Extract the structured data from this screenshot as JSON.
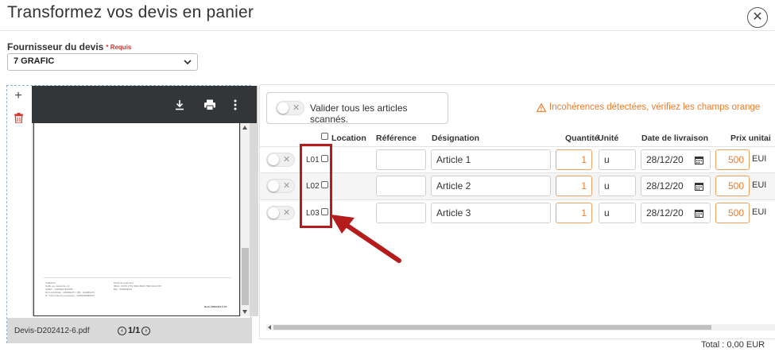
{
  "header": {
    "title": "Transformez vos devis en panier"
  },
  "supplier": {
    "label": "Fournisseur du devis",
    "required": "* Requis",
    "value": "7 GRAFIC"
  },
  "viewer": {
    "file_name": "Devis-D202412-6.pdf",
    "page_indicator": "1/1",
    "footer_col1": [
      "7GRAFIC",
      "SARL au capital de 1 €",
      "SIRET : 34998947500055",
      "RCS GRASSE : 349989475 / RM : 349989475",
      "N° TVA Intracommunautaire : FR89349989475"
    ],
    "footer_col2": [
      "Mode de paiement",
      "IBAN : FR76 1751 8004 8000 7830 4012 367",
      "BIC : 580000RX2"
    ],
    "footer_ref": "Devis D202412-6 1/1"
  },
  "panel": {
    "validate_label": "Valider tous les articles scannés.",
    "warning": "Incohérences détectées, vérifiez les champs orange",
    "columns": {
      "location": "Location",
      "reference": "Référence",
      "designation": "Désignation",
      "quantity": "Quantité",
      "unit": "Unité",
      "delivery_date": "Date de livraison",
      "unit_price": "Prix unitai"
    },
    "rows": [
      {
        "location": "L01",
        "reference": "",
        "designation": "Article 1",
        "quantity": "1",
        "unit": "u",
        "date": "28/12/20",
        "price": "500",
        "currency": "EUI"
      },
      {
        "location": "L02",
        "reference": "",
        "designation": "Article 2",
        "quantity": "1",
        "unit": "u",
        "date": "28/12/20",
        "price": "500",
        "currency": "EUI"
      },
      {
        "location": "L03",
        "reference": "",
        "designation": "Article 3",
        "quantity": "1",
        "unit": "u",
        "date": "28/12/20",
        "price": "500",
        "currency": "EUI"
      }
    ],
    "total": "Total : 0,00 EUR"
  },
  "colors": {
    "warning": "#ee7c2c",
    "annotation": "#b51c1c",
    "viewer_toolbar": "#323639"
  }
}
